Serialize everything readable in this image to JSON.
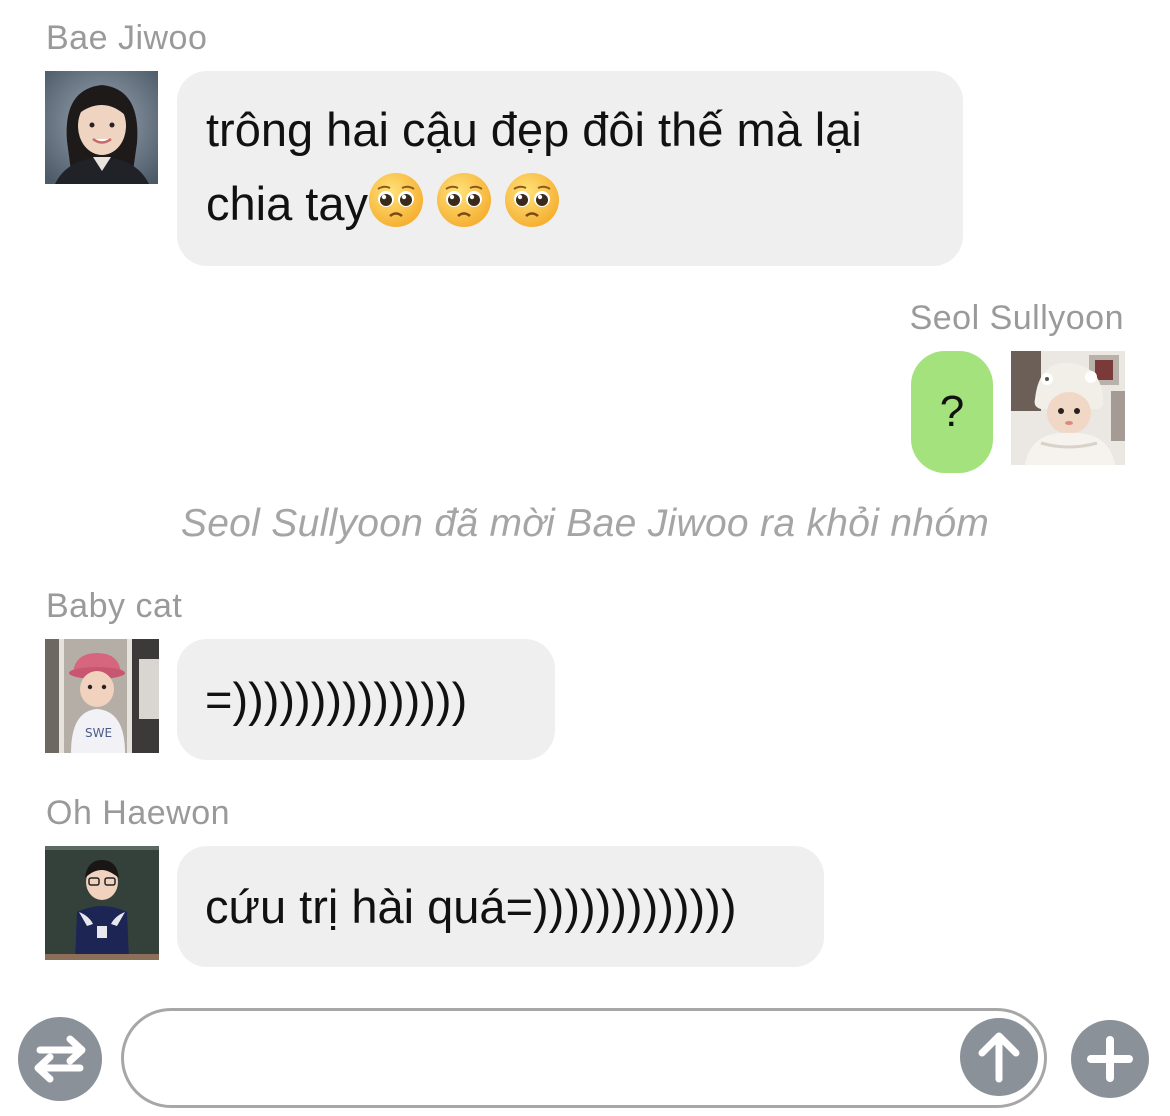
{
  "messages": [
    {
      "sender": "Bae Jiwoo",
      "line1": "trông hai cậu đẹp đôi thế mà lại",
      "line2": "chia tay",
      "emoji": [
        "pleading-face-emoji",
        "pleading-face-emoji",
        "pleading-face-emoji"
      ]
    },
    {
      "sender": "Seol Sullyoon",
      "text": "?"
    },
    {
      "system": "Seol Sullyoon đã mời Bae Jiwoo ra khỏi nhóm"
    },
    {
      "sender": "Baby cat",
      "text": "=)))))))))))))))"
    },
    {
      "sender": "Oh Haewon",
      "text": "cứu trị hài quá=)))))))))))))"
    }
  ],
  "composer": {
    "swap_icon": "swap-arrows-icon",
    "send_icon": "arrow-up-icon",
    "add_icon": "plus-icon"
  },
  "colors": {
    "incoming_bubble": "#efefef",
    "outgoing_bubble": "#a3e27c",
    "sender_name": "#9a9a9a",
    "system_text": "#a5a5a5",
    "button": "#8a9199"
  }
}
